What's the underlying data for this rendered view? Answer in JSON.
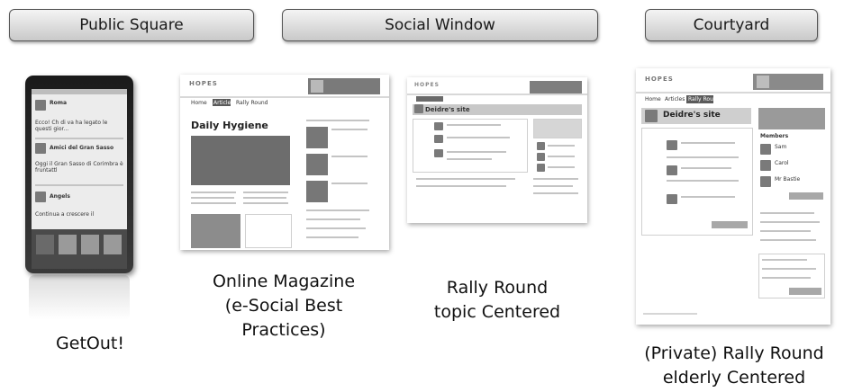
{
  "tiers": {
    "public": "Public Square",
    "social": "Social Window",
    "courtyard": "Courtyard"
  },
  "captions": {
    "getout": "GetOut!",
    "magazine": [
      "Online Magazine",
      "(e-Social Best",
      "Practices)"
    ],
    "rally_topic": [
      "Rally Round",
      "topic Centered"
    ],
    "rally_elderly": [
      "(Private) Rally Round",
      "elderly Centered"
    ]
  },
  "phone_app": {
    "posts": [
      {
        "author": "Roma",
        "text": "Ecco! Ch di va ha legato le questi gior..."
      },
      {
        "author": "Amici del Gran Sasso",
        "text": "Oggi il Gran Sasso di Corimbra è fruntattl"
      },
      {
        "author": "Angels",
        "text": "Continua a crescere il"
      }
    ]
  },
  "magazine_screen": {
    "logo": "HOPES",
    "tabs": [
      "Home",
      "Articles",
      "Rally Round"
    ],
    "article_title": "Daily Hygiene"
  },
  "rally_topic_screen": {
    "logo": "HOPES",
    "site_title": "Deidre's site"
  },
  "rally_elderly_screen": {
    "logo": "HOPES",
    "tabs": [
      "Home",
      "Articles",
      "Rally Round"
    ],
    "site_title": "Deidre's site",
    "members_heading": "Members",
    "members": [
      "Sam",
      "Carol",
      "Mr Bastie"
    ]
  }
}
